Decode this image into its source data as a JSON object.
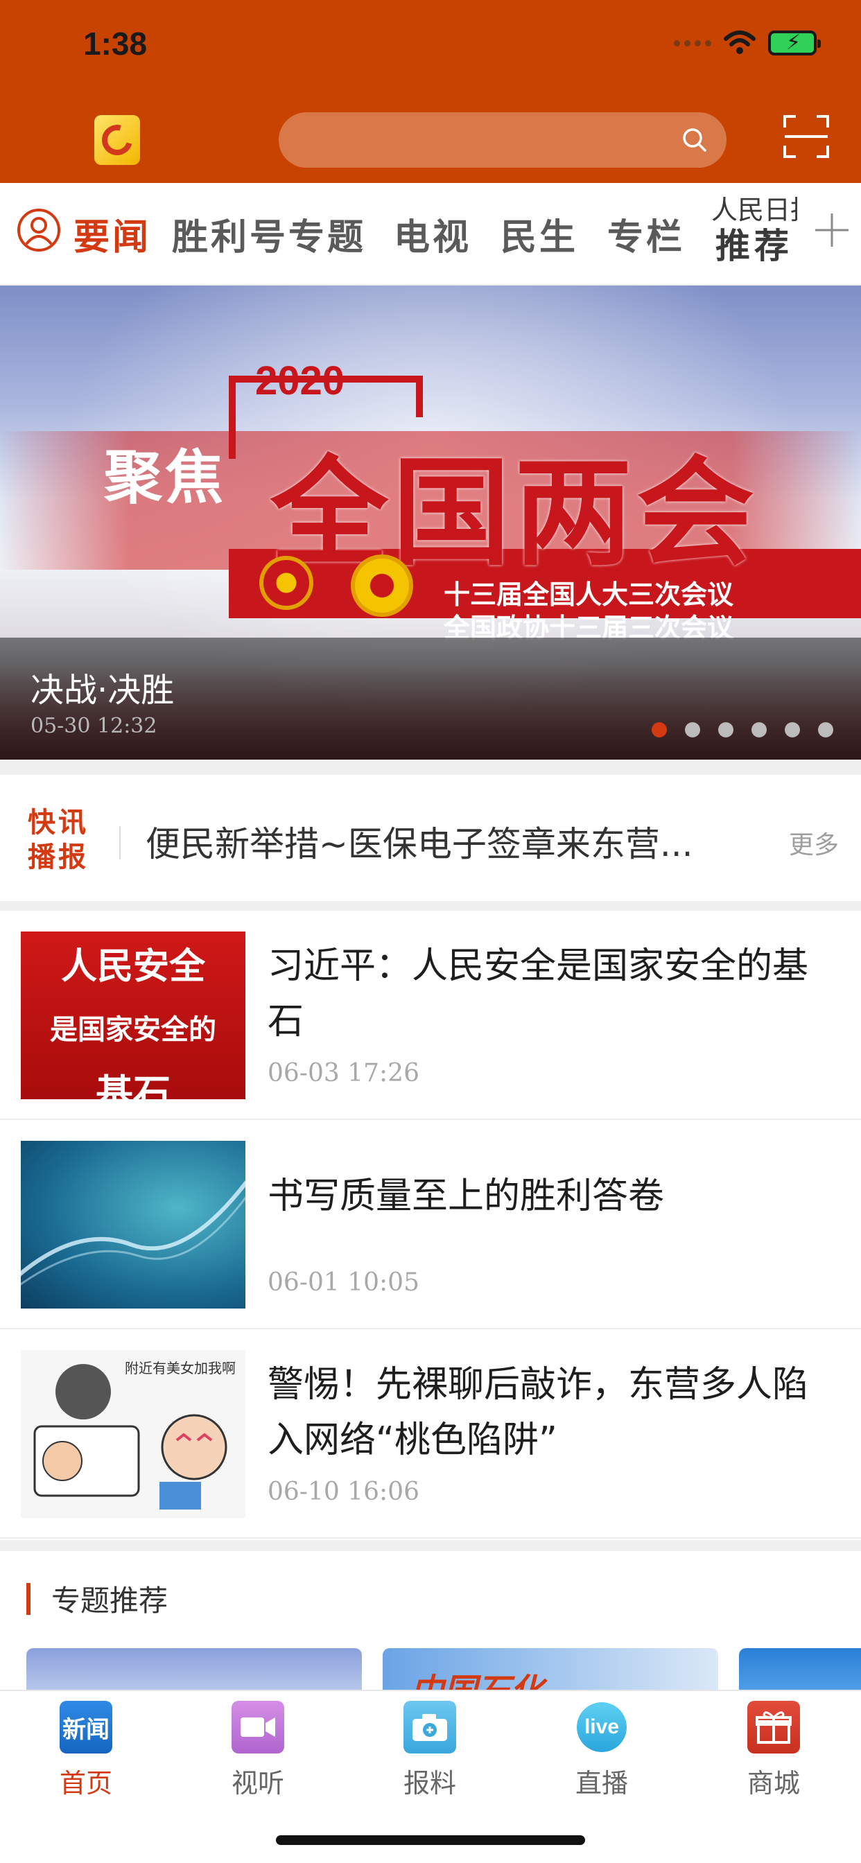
{
  "status_bar": {
    "time": "1:38"
  },
  "header": {
    "search_placeholder": ""
  },
  "tabs": {
    "items": [
      {
        "label": "要闻",
        "active": true
      },
      {
        "label": "胜利号",
        "active": false
      },
      {
        "label": "专题",
        "active": false
      },
      {
        "label": "电视",
        "active": false
      },
      {
        "label": "民生",
        "active": false
      },
      {
        "label": "专栏",
        "active": false
      }
    ],
    "rmrb_line1": "人民日报",
    "rmrb_line2": "推荐"
  },
  "banner": {
    "image_year": "2020",
    "image_left": "聚焦",
    "image_main": "全国两会",
    "image_sub_1": "十三届全国人大三次会议",
    "image_sub_2": "全国政协十三届三次会议",
    "title": "决战·决胜",
    "time": "05-30 12:32",
    "page_count": 6,
    "active_page": 1
  },
  "flash": {
    "logo_line1": "快讯",
    "logo_line2": "播报",
    "text": "便民新举措~医保电子签章来东营...",
    "more": "更多"
  },
  "news": [
    {
      "title": "习近平：人民安全是国家安全的基石",
      "time": "06-03 17:26",
      "thumb_text": [
        "人民安全",
        "是国家安全的",
        "基石"
      ]
    },
    {
      "title": "书写质量至上的胜利答卷",
      "time": "06-01 10:05"
    },
    {
      "title": "警惕！先裸聊后敲诈，东营多人陷入网络“桃色陷阱”",
      "time": "06-10 16:06",
      "thumb_text": "附近有美女加我啊"
    }
  ],
  "topics": {
    "title": "专题推荐",
    "card2_text": "中国石化"
  },
  "tabbar": {
    "items": [
      {
        "label": "首页",
        "icon": "news-icon",
        "active": true
      },
      {
        "label": "视听",
        "icon": "video-camera-icon",
        "active": false
      },
      {
        "label": "报料",
        "icon": "camera-icon",
        "active": false
      },
      {
        "label": "直播",
        "icon": "live-icon",
        "active": false
      },
      {
        "label": "商城",
        "icon": "gift-icon",
        "active": false
      }
    ]
  },
  "colors": {
    "brand": "#c94300",
    "accent": "#d43a12"
  }
}
